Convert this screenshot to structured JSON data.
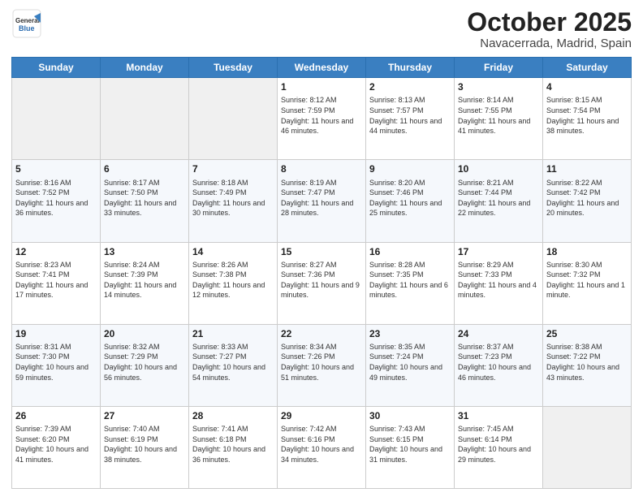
{
  "header": {
    "logo_general": "General",
    "logo_blue": "Blue",
    "month_title": "October 2025",
    "location": "Navacerrada, Madrid, Spain"
  },
  "weekdays": [
    "Sunday",
    "Monday",
    "Tuesday",
    "Wednesday",
    "Thursday",
    "Friday",
    "Saturday"
  ],
  "weeks": [
    [
      {
        "day": "",
        "info": ""
      },
      {
        "day": "",
        "info": ""
      },
      {
        "day": "",
        "info": ""
      },
      {
        "day": "1",
        "info": "Sunrise: 8:12 AM\nSunset: 7:59 PM\nDaylight: 11 hours\nand 46 minutes."
      },
      {
        "day": "2",
        "info": "Sunrise: 8:13 AM\nSunset: 7:57 PM\nDaylight: 11 hours\nand 44 minutes."
      },
      {
        "day": "3",
        "info": "Sunrise: 8:14 AM\nSunset: 7:55 PM\nDaylight: 11 hours\nand 41 minutes."
      },
      {
        "day": "4",
        "info": "Sunrise: 8:15 AM\nSunset: 7:54 PM\nDaylight: 11 hours\nand 38 minutes."
      }
    ],
    [
      {
        "day": "5",
        "info": "Sunrise: 8:16 AM\nSunset: 7:52 PM\nDaylight: 11 hours\nand 36 minutes."
      },
      {
        "day": "6",
        "info": "Sunrise: 8:17 AM\nSunset: 7:50 PM\nDaylight: 11 hours\nand 33 minutes."
      },
      {
        "day": "7",
        "info": "Sunrise: 8:18 AM\nSunset: 7:49 PM\nDaylight: 11 hours\nand 30 minutes."
      },
      {
        "day": "8",
        "info": "Sunrise: 8:19 AM\nSunset: 7:47 PM\nDaylight: 11 hours\nand 28 minutes."
      },
      {
        "day": "9",
        "info": "Sunrise: 8:20 AM\nSunset: 7:46 PM\nDaylight: 11 hours\nand 25 minutes."
      },
      {
        "day": "10",
        "info": "Sunrise: 8:21 AM\nSunset: 7:44 PM\nDaylight: 11 hours\nand 22 minutes."
      },
      {
        "day": "11",
        "info": "Sunrise: 8:22 AM\nSunset: 7:42 PM\nDaylight: 11 hours\nand 20 minutes."
      }
    ],
    [
      {
        "day": "12",
        "info": "Sunrise: 8:23 AM\nSunset: 7:41 PM\nDaylight: 11 hours\nand 17 minutes."
      },
      {
        "day": "13",
        "info": "Sunrise: 8:24 AM\nSunset: 7:39 PM\nDaylight: 11 hours\nand 14 minutes."
      },
      {
        "day": "14",
        "info": "Sunrise: 8:26 AM\nSunset: 7:38 PM\nDaylight: 11 hours\nand 12 minutes."
      },
      {
        "day": "15",
        "info": "Sunrise: 8:27 AM\nSunset: 7:36 PM\nDaylight: 11 hours\nand 9 minutes."
      },
      {
        "day": "16",
        "info": "Sunrise: 8:28 AM\nSunset: 7:35 PM\nDaylight: 11 hours\nand 6 minutes."
      },
      {
        "day": "17",
        "info": "Sunrise: 8:29 AM\nSunset: 7:33 PM\nDaylight: 11 hours\nand 4 minutes."
      },
      {
        "day": "18",
        "info": "Sunrise: 8:30 AM\nSunset: 7:32 PM\nDaylight: 11 hours\nand 1 minute."
      }
    ],
    [
      {
        "day": "19",
        "info": "Sunrise: 8:31 AM\nSunset: 7:30 PM\nDaylight: 10 hours\nand 59 minutes."
      },
      {
        "day": "20",
        "info": "Sunrise: 8:32 AM\nSunset: 7:29 PM\nDaylight: 10 hours\nand 56 minutes."
      },
      {
        "day": "21",
        "info": "Sunrise: 8:33 AM\nSunset: 7:27 PM\nDaylight: 10 hours\nand 54 minutes."
      },
      {
        "day": "22",
        "info": "Sunrise: 8:34 AM\nSunset: 7:26 PM\nDaylight: 10 hours\nand 51 minutes."
      },
      {
        "day": "23",
        "info": "Sunrise: 8:35 AM\nSunset: 7:24 PM\nDaylight: 10 hours\nand 49 minutes."
      },
      {
        "day": "24",
        "info": "Sunrise: 8:37 AM\nSunset: 7:23 PM\nDaylight: 10 hours\nand 46 minutes."
      },
      {
        "day": "25",
        "info": "Sunrise: 8:38 AM\nSunset: 7:22 PM\nDaylight: 10 hours\nand 43 minutes."
      }
    ],
    [
      {
        "day": "26",
        "info": "Sunrise: 7:39 AM\nSunset: 6:20 PM\nDaylight: 10 hours\nand 41 minutes."
      },
      {
        "day": "27",
        "info": "Sunrise: 7:40 AM\nSunset: 6:19 PM\nDaylight: 10 hours\nand 38 minutes."
      },
      {
        "day": "28",
        "info": "Sunrise: 7:41 AM\nSunset: 6:18 PM\nDaylight: 10 hours\nand 36 minutes."
      },
      {
        "day": "29",
        "info": "Sunrise: 7:42 AM\nSunset: 6:16 PM\nDaylight: 10 hours\nand 34 minutes."
      },
      {
        "day": "30",
        "info": "Sunrise: 7:43 AM\nSunset: 6:15 PM\nDaylight: 10 hours\nand 31 minutes."
      },
      {
        "day": "31",
        "info": "Sunrise: 7:45 AM\nSunset: 6:14 PM\nDaylight: 10 hours\nand 29 minutes."
      },
      {
        "day": "",
        "info": ""
      }
    ]
  ]
}
